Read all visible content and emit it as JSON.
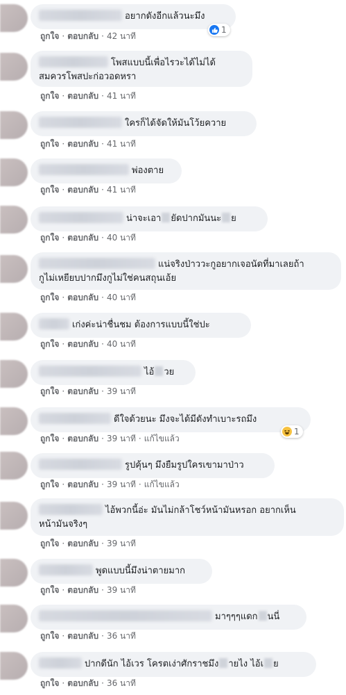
{
  "actions": {
    "like": "ถูกใจ",
    "reply": "ตอบกลับ",
    "edited": "แก้ไขแล้ว"
  },
  "comments": [
    {
      "text": "อยากดังอีกแล้วนะมึง",
      "time": "42 นาที",
      "reaction": {
        "icon": "like-icon",
        "count": "1"
      }
    },
    {
      "text1": "โพสแบบนี้เพื่อไรวะได้ไม่ได้",
      "text2": "สมควรโพสปะก่อวอดหรา",
      "time": "41 นาที"
    },
    {
      "text": "ใครก็ได้จัดให้มันโว้ยควาย",
      "time": "41 นาที"
    },
    {
      "text": "พ่องตาย",
      "time": "41 นาที"
    },
    {
      "text_a": "น่าจะเอา",
      "text_b": "ยัดปากมันนะ",
      "text_c": "ย",
      "time": "40 นาที"
    },
    {
      "text1": "แน่จริงป่าววะกูอยากเจอนัดที่มาเลยถ้า",
      "text2": "กูไม่เหยียบปากมึงกูไม่ใช่คนสถุนเอ้ย",
      "time": "40 นาที"
    },
    {
      "text": "เก่งค่ะน่าชื่นชม ต้องการแบบนี้ใช่ปะ",
      "time": "40 นาที"
    },
    {
      "text_a": "ไอ้",
      "text_b": "วย",
      "time": "39 นาที"
    },
    {
      "text": "ดีใจด้วยนะ มึงจะได้มีดังทำเบาะรถมึง",
      "time": "39 นาที",
      "edited": true,
      "reaction": {
        "icon": "haha-icon",
        "count": "1"
      }
    },
    {
      "text": "รูปคุ้นๆ มึงยืมรูปใครเขามาป่าว",
      "time": "39 นาที",
      "edited": true
    },
    {
      "text1": "ไอ้พวกนี้อ่ะ มันไม่กล้าโชว์หน้ามันหรอก อยากเห็น",
      "text2": "หน้ามันจริงๆ",
      "time": "39 นาที"
    },
    {
      "text": "พูดแบบนี้มึงน่าตายมาก",
      "time": "39 นาที"
    },
    {
      "text_a": "มาๆๆๆแดก",
      "text_b": "นนี่",
      "time": "36 นาที"
    },
    {
      "text_a": "ปากดีนัก ไอ้เวร โครตเง่าศักราชมึง",
      "text_b": "ายไง ไอ้เ",
      "text_c": "ย",
      "time": "36 นาที"
    }
  ]
}
